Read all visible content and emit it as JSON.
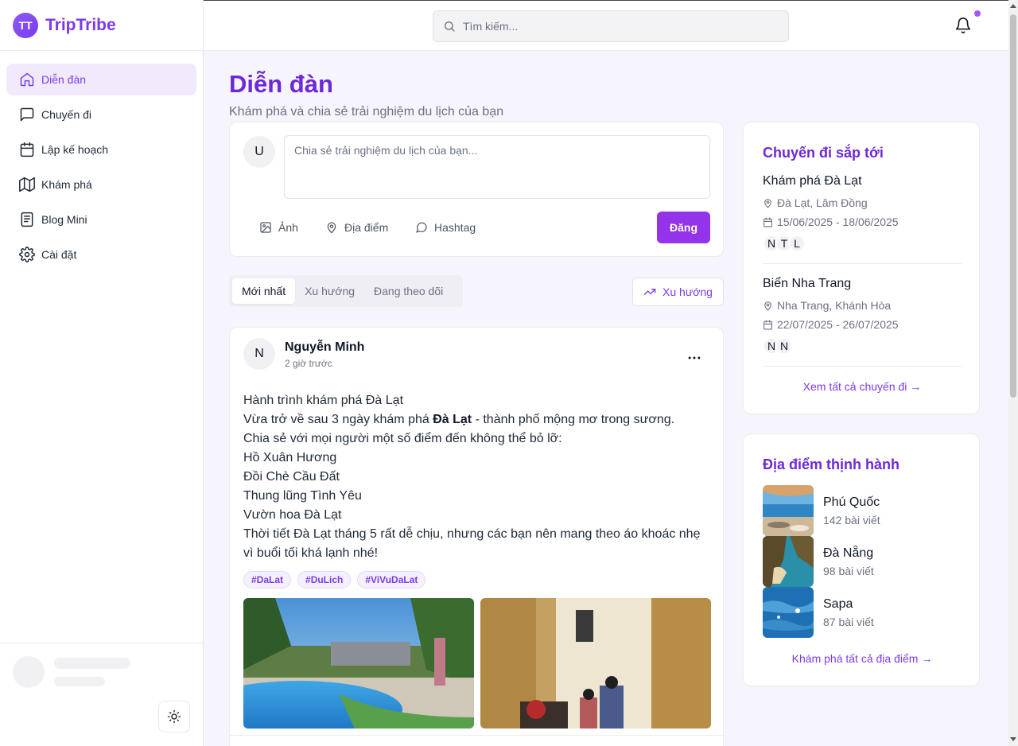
{
  "brand": {
    "logo": "TT",
    "name": "TripTribe"
  },
  "sidebar": {
    "items": [
      {
        "label": "Diễn đàn",
        "icon": "home-icon",
        "active": true
      },
      {
        "label": "Chuyến đi",
        "icon": "message-icon"
      },
      {
        "label": "Lập kế hoạch",
        "icon": "calendar-icon"
      },
      {
        "label": "Khám phá",
        "icon": "map-icon"
      },
      {
        "label": "Blog Mini",
        "icon": "book-icon"
      },
      {
        "label": "Cài đặt",
        "icon": "gear-icon"
      }
    ]
  },
  "search": {
    "placeholder": "Tìm kiếm..."
  },
  "page": {
    "title": "Diễn đàn",
    "subtitle": "Khám phá và chia sẻ trải nghiệm du lịch của bạn"
  },
  "composer": {
    "avatar": "U",
    "placeholder": "Chia sẻ trải nghiệm du lịch của bạn...",
    "photo_label": "Ảnh",
    "location_label": "Địa điểm",
    "hashtag_label": "Hashtag",
    "post_label": "Đăng"
  },
  "tabs": [
    "Mới nhất",
    "Xu hướng",
    "Đang theo dõi"
  ],
  "trend_button": "Xu hướng",
  "post": {
    "avatar": "N",
    "author": "Nguyễn Minh",
    "time": "2 giờ trước",
    "line1": "Hành trình khám phá Đà Lạt",
    "line2_pre": "Vừa trở về sau 3 ngày khám phá ",
    "line2_bold": "Đà Lạt",
    "line2_post": " - thành phố mộng mơ trong sương.",
    "line3": "Chia sẻ với mọi người một số điểm đến không thể bỏ lỡ:",
    "line4": "Hồ Xuân Hương",
    "line5": "Đồi Chè Cầu Đất",
    "line6": "Thung lũng Tình Yêu",
    "line7": "Vườn hoa Đà Lạt",
    "line8": "Thời tiết Đà Lạt tháng 5 rất dễ chịu, nhưng các bạn nên mang theo áo khoác nhẹ vì buổi tối khá lạnh nhé!",
    "tags": [
      "#DaLat",
      "#DuLich",
      "#ViVuDaLat"
    ]
  },
  "trips": {
    "title": "Chuyến đi sắp tới",
    "items": [
      {
        "name": "Khám phá Đà Lạt",
        "location": "Đà Lạt, Lâm Đồng",
        "dates": "15/06/2025 - 18/06/2025",
        "members": [
          "N",
          "T",
          "L"
        ]
      },
      {
        "name": "Biển Nha Trang",
        "location": "Nha Trang, Khánh Hòa",
        "dates": "22/07/2025 - 26/07/2025",
        "members": [
          "N",
          "N"
        ]
      }
    ],
    "link": "Xem tất cả chuyến đi →"
  },
  "places": {
    "title": "Địa điểm thịnh hành",
    "items": [
      {
        "name": "Phú Quốc",
        "count": "142 bài viết"
      },
      {
        "name": "Đà Nẵng",
        "count": "98 bài viết"
      },
      {
        "name": "Sapa",
        "count": "87 bài viết"
      }
    ],
    "link": "Khám phá tất cả địa điểm →"
  },
  "colors": {
    "accent": "#7c3aed",
    "primary_button": "#9333ea",
    "notification_dot": "#a855f7"
  }
}
